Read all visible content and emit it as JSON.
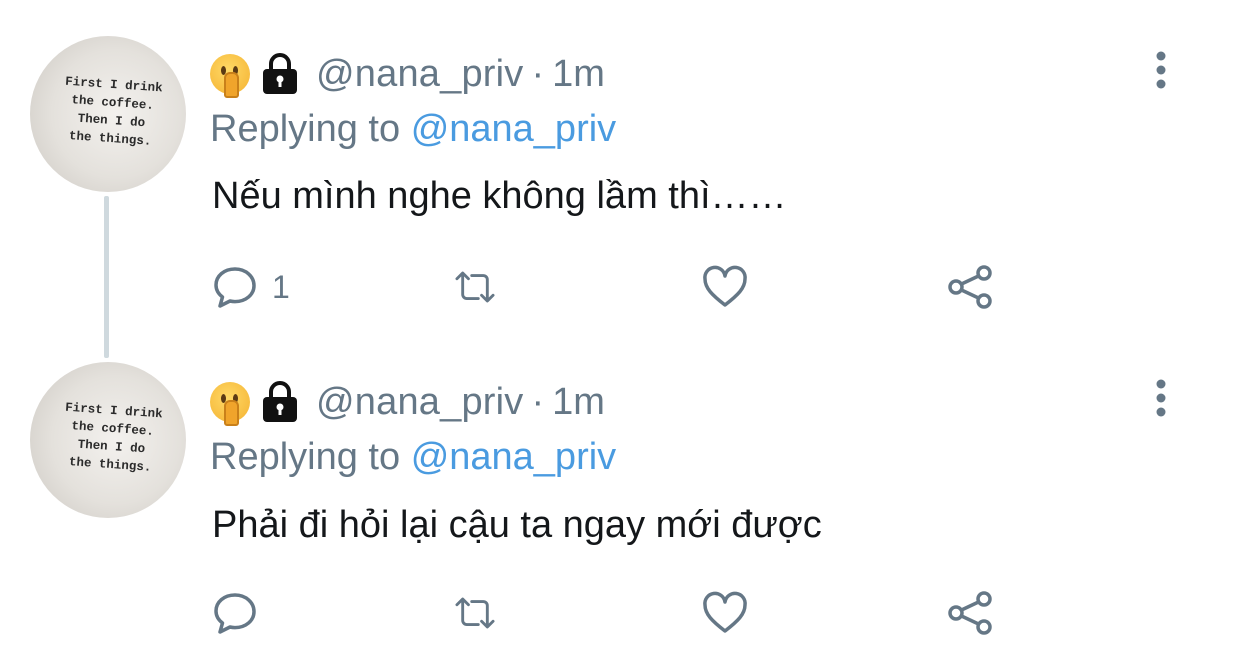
{
  "tweets": [
    {
      "avatar_text": [
        "First I drink",
        "the coffee.",
        "Then I do",
        "the things."
      ],
      "handle": "@nana_priv",
      "separator": "·",
      "time": "1m",
      "replying_prefix": "Replying to",
      "replying_to": "@nana_priv",
      "text": "Nếu mình nghe không lầm thì……",
      "reply_count": "1",
      "icons": [
        "shushing-face-icon",
        "lock-icon",
        "more-icon",
        "reply-icon",
        "retweet-icon",
        "like-icon",
        "share-icon"
      ]
    },
    {
      "avatar_text": [
        "First I drink",
        "the coffee.",
        "Then I do",
        "the things."
      ],
      "handle": "@nana_priv",
      "separator": "·",
      "time": "1m",
      "replying_prefix": "Replying to",
      "replying_to": "@nana_priv",
      "text": "Phải đi hỏi lại cậu ta ngay mới được",
      "reply_count": "",
      "icons": [
        "shushing-face-icon",
        "lock-icon",
        "more-icon",
        "reply-icon",
        "retweet-icon",
        "like-icon",
        "share-icon"
      ]
    }
  ],
  "colors": {
    "secondary_text": "#657786",
    "mention": "#4a9be0",
    "primary_text": "#14171a",
    "thread_line": "#cfd9de"
  }
}
